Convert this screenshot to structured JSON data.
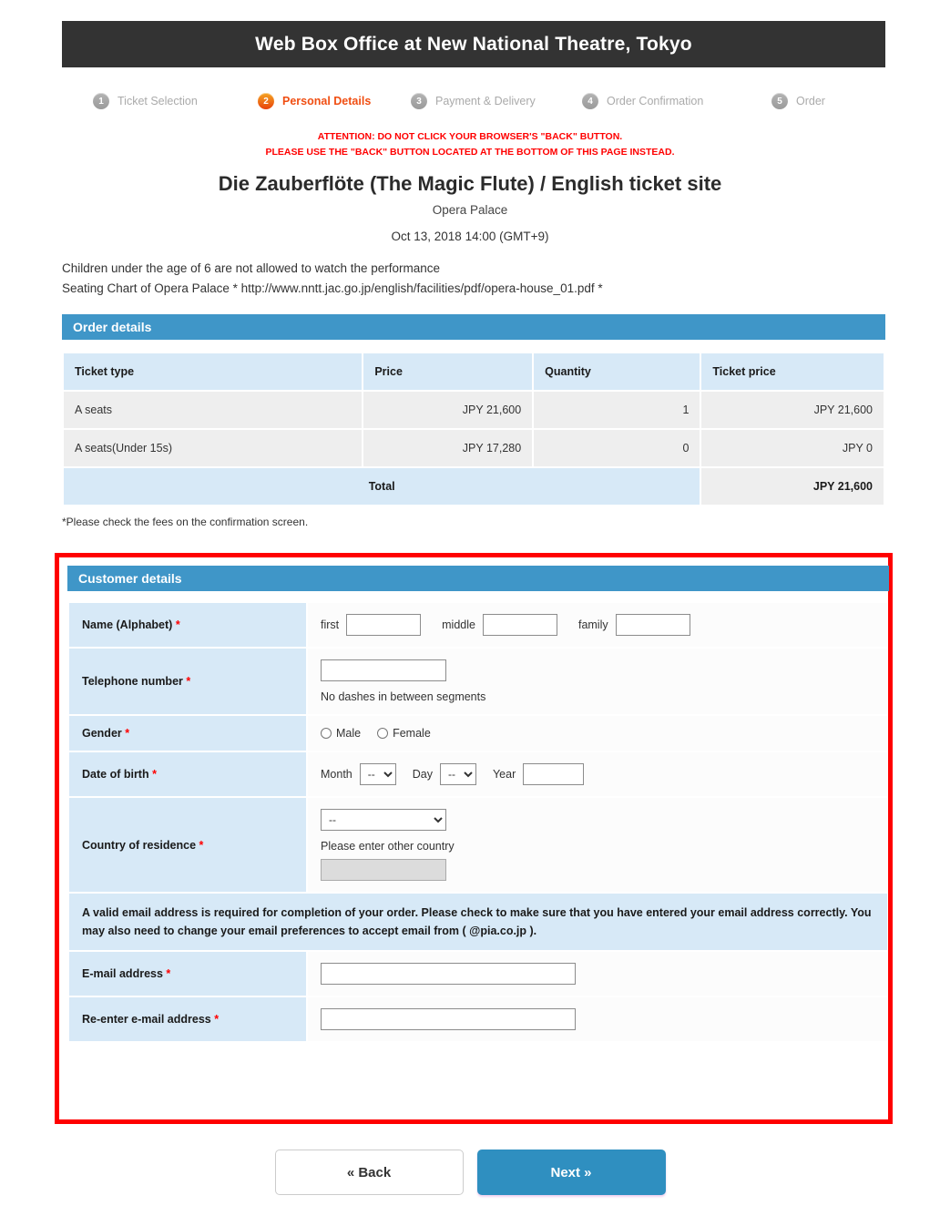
{
  "header": {
    "title": "Web Box Office at New National Theatre, Tokyo",
    "bar_color": "#333333"
  },
  "steps": [
    {
      "num": "1",
      "label": "Ticket Selection",
      "active": false
    },
    {
      "num": "2",
      "label": "Personal Details",
      "active": true
    },
    {
      "num": "3",
      "label": "Payment & Delivery",
      "active": false
    },
    {
      "num": "4",
      "label": "Order Confirmation",
      "active": false
    },
    {
      "num": "5",
      "label": "Order",
      "active": false
    }
  ],
  "step_colors": {
    "active_text": "#f04e12",
    "inactive_text": "#aaaaaa",
    "active_bullet": "#e8420c"
  },
  "attention": {
    "line1": "ATTENTION: DO NOT CLICK YOUR BROWSER'S \"BACK\" BUTTON.",
    "line2": "PLEASE USE THE \"BACK\" BUTTON LOCATED AT THE BOTTOM OF THIS PAGE INSTEAD.",
    "color": "#ff0000"
  },
  "performance": {
    "title": "Die Zauberflöte (The Magic Flute) / English ticket site",
    "venue": "Opera Palace",
    "datetime": "Oct 13, 2018 14:00  (GMT+9)"
  },
  "notes": {
    "line1": "Children under the age of 6 are not allowed to watch the performance",
    "line2": "Seating Chart of Opera Palace * http://www.nntt.jac.go.jp/english/facilities/pdf/opera-house_01.pdf *"
  },
  "order_details": {
    "band_label": "Order details",
    "band_color": "#3f96c8",
    "columns": [
      "Ticket type",
      "Price",
      "Quantity",
      "Ticket price"
    ],
    "rows": [
      {
        "type": "A seats",
        "price": "JPY  21,600",
        "quantity": "1",
        "ticket_price": "JPY  21,600"
      },
      {
        "type": "A seats(Under 15s)",
        "price": "JPY  17,280",
        "quantity": "0",
        "ticket_price": "JPY  0"
      }
    ],
    "total_label": "Total",
    "total_value": "JPY  21,600",
    "fee_note": "*Please check the fees on the confirmation screen."
  },
  "customer_details": {
    "band_label": "Customer details",
    "highlight_border_color": "#ff0000",
    "name": {
      "label": "Name (Alphabet)",
      "required_mark": "*",
      "first_label": "first",
      "middle_label": "middle",
      "family_label": "family",
      "first_value": "",
      "middle_value": "",
      "family_value": ""
    },
    "telephone": {
      "label": "Telephone number",
      "required_mark": "*",
      "value": "",
      "hint": "No dashes in between segments"
    },
    "gender": {
      "label": "Gender",
      "required_mark": "*",
      "options": [
        "Male",
        "Female"
      ],
      "selected": ""
    },
    "dob": {
      "label": "Date of birth",
      "required_mark": "*",
      "month_label": "Month",
      "month_value": "--",
      "day_label": "Day",
      "day_value": "--",
      "year_label": "Year",
      "year_value": ""
    },
    "country": {
      "label": "Country of residence",
      "required_mark": "*",
      "select_value": "--",
      "other_hint": "Please enter other country",
      "other_value": "",
      "other_disabled": true
    },
    "email_notice": "A valid email address is required for completion of your order. Please check to make sure that you have entered your email address correctly. You may also need to change your email preferences to accept email from ( @pia.co.jp ).",
    "email": {
      "label": "E-mail address",
      "required_mark": "*",
      "value": ""
    },
    "email_confirm": {
      "label": "Re-enter e-mail address",
      "required_mark": "*",
      "value": ""
    }
  },
  "footer": {
    "back_label": "« Back",
    "next_label": "Next »",
    "next_color": "#2f8fc0"
  }
}
